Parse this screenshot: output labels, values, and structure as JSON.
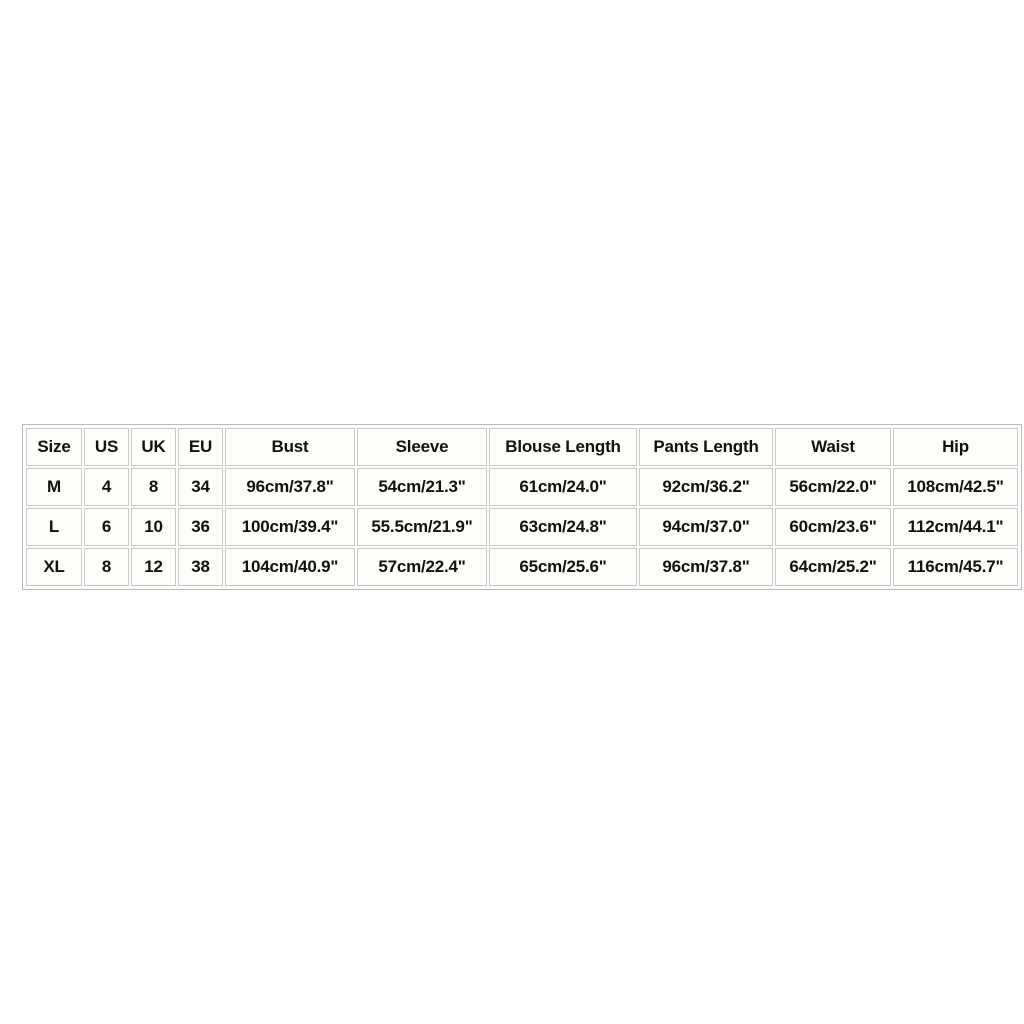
{
  "table": {
    "name": "size-chart",
    "columns": [
      {
        "key": "size",
        "label": "Size"
      },
      {
        "key": "us",
        "label": "US"
      },
      {
        "key": "uk",
        "label": "UK"
      },
      {
        "key": "eu",
        "label": "EU"
      },
      {
        "key": "bust",
        "label": "Bust"
      },
      {
        "key": "sleeve",
        "label": "Sleeve"
      },
      {
        "key": "blouse_length",
        "label": "Blouse Length"
      },
      {
        "key": "pants_length",
        "label": "Pants Length"
      },
      {
        "key": "waist",
        "label": "Waist"
      },
      {
        "key": "hip",
        "label": "Hip"
      }
    ],
    "rows": [
      {
        "size": "M",
        "us": "4",
        "uk": "8",
        "eu": "34",
        "bust": "96cm/37.8\"",
        "sleeve": "54cm/21.3\"",
        "blouse_length": "61cm/24.0\"",
        "pants_length": "92cm/36.2\"",
        "waist": "56cm/22.0\"",
        "hip": "108cm/42.5\""
      },
      {
        "size": "L",
        "us": "6",
        "uk": "10",
        "eu": "36",
        "bust": "100cm/39.4\"",
        "sleeve": "55.5cm/21.9\"",
        "blouse_length": "63cm/24.8\"",
        "pants_length": "94cm/37.0\"",
        "waist": "60cm/23.6\"",
        "hip": "112cm/44.1\""
      },
      {
        "size": "XL",
        "us": "8",
        "uk": "12",
        "eu": "38",
        "bust": "104cm/40.9\"",
        "sleeve": "57cm/22.4\"",
        "blouse_length": "65cm/25.6\"",
        "pants_length": "96cm/37.8\"",
        "waist": "64cm/25.2\"",
        "hip": "116cm/45.7\""
      }
    ]
  },
  "colors": {
    "page_background": "#ffffff",
    "cell_background": "#fdfdfa",
    "cell_border": "#c9c9c6",
    "table_border": "#b9b9b9",
    "text": "#111111"
  }
}
